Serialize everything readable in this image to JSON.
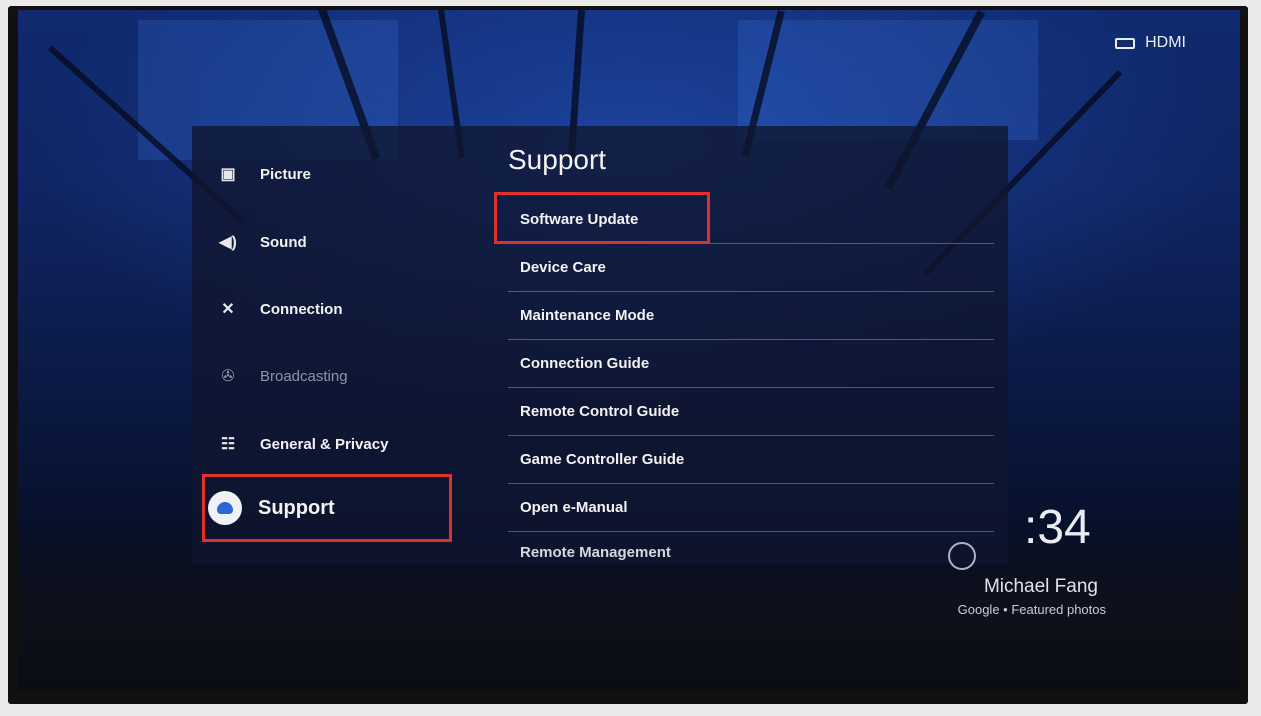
{
  "tv": {
    "input_label": "HDMI",
    "clock": ":34",
    "photo_credit_name": "Michael Fang",
    "photo_credit_source": "Google • Featured photos"
  },
  "sidebar": {
    "items": [
      {
        "label": "Picture",
        "icon": "picture-icon",
        "state": "normal"
      },
      {
        "label": "Sound",
        "icon": "speaker-icon",
        "state": "normal"
      },
      {
        "label": "Connection",
        "icon": "connection-icon",
        "state": "normal"
      },
      {
        "label": "Broadcasting",
        "icon": "satellite-icon",
        "state": "disabled"
      },
      {
        "label": "General & Privacy",
        "icon": "settings-list-icon",
        "state": "normal"
      },
      {
        "label": "Support",
        "icon": "support-cloud-icon",
        "state": "selected"
      }
    ]
  },
  "content": {
    "title": "Support",
    "options": [
      "Software Update",
      "Device Care",
      "Maintenance Mode",
      "Connection Guide",
      "Remote Control Guide",
      "Game Controller Guide",
      "Open e-Manual",
      "Remote Management"
    ]
  },
  "highlights": {
    "color": "#e0302c",
    "targets": [
      "Support",
      "Software Update"
    ]
  }
}
